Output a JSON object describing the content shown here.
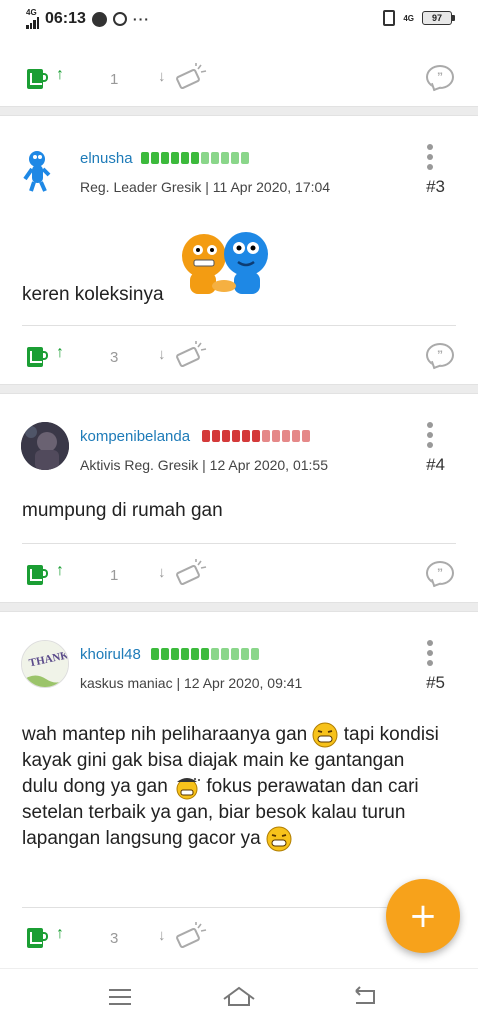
{
  "status_bar": {
    "network_left": "4G",
    "time": "06:13",
    "more": "···",
    "network_right": "4G",
    "battery": "97"
  },
  "top_actions": {
    "count": "1"
  },
  "posts": [
    {
      "username": "elnusha",
      "rep_color": "#3cba3c",
      "rep_filled": 6,
      "rep_total": 11,
      "meta": "Reg. Leader Gresik | 11 Apr 2020, 17:04",
      "number": "#3",
      "body": "keren koleksinya",
      "vote_count": "3"
    },
    {
      "username": "kompenibelanda",
      "rep_color": "#d43a3a",
      "rep_filled": 6,
      "rep_total": 11,
      "meta": "Aktivis Reg. Gresik | 12 Apr 2020, 01:55",
      "number": "#4",
      "body": "mumpung di rumah gan",
      "vote_count": "1"
    },
    {
      "username": "khoirul48",
      "rep_color": "#3cba3c",
      "rep_filled": 6,
      "rep_total": 11,
      "meta": "kaskus maniac | 12 Apr 2020, 09:41",
      "number": "#5",
      "body_parts": [
        "wah mantep nih peliharaanya gan ",
        " tapi kondisi kayak gini gak bisa diajak main ke gantangan dulu dong ya gan ",
        " fokus perawatan dan cari setelan terbaik ya gan, biar besok kalau turun lapangan langsung gacor ya "
      ],
      "vote_count": "3"
    }
  ],
  "avatar_text": "THANK YOU",
  "colors": {
    "cendol": "#1b9e34",
    "username": "#1e7bb8",
    "fab": "#f7a21b"
  },
  "fab_label": "+"
}
